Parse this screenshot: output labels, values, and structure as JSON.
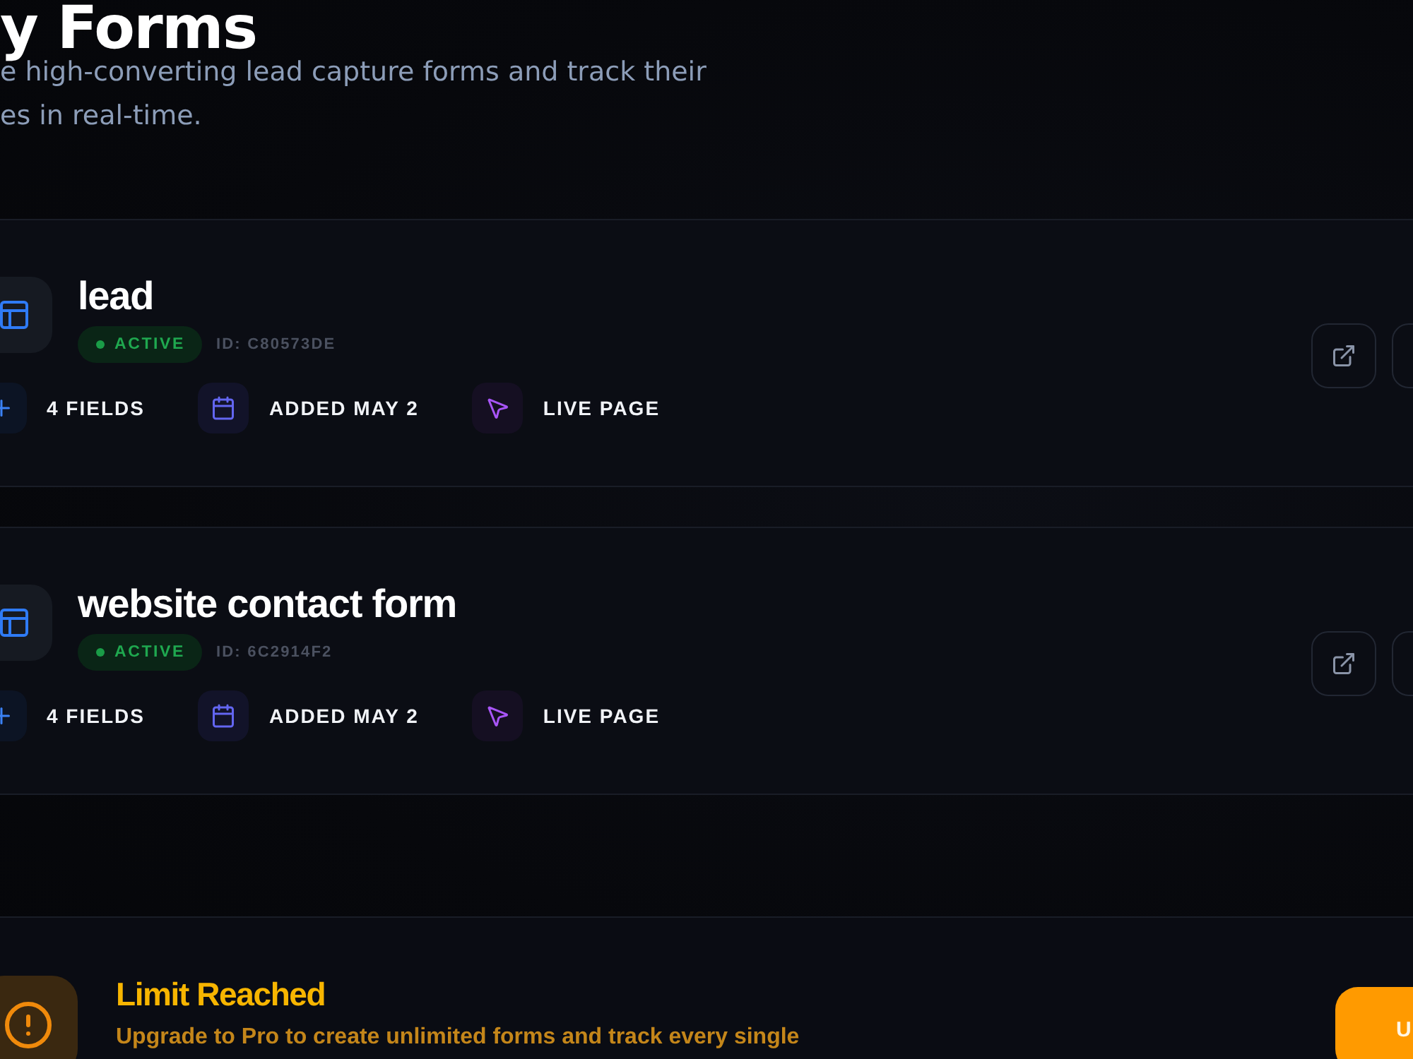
{
  "header": {
    "title": "y Forms",
    "subtitle_lines": [
      "e high-converting lead capture forms and track their",
      "es in real-time."
    ]
  },
  "forms": [
    {
      "name": "lead",
      "status": "ACTIVE",
      "id_label": "ID: C80573DE",
      "stats": [
        {
          "kind": "fields",
          "label": "4 FIELDS"
        },
        {
          "kind": "date",
          "label": "ADDED MAY 2"
        },
        {
          "kind": "page",
          "label": "LIVE PAGE"
        }
      ]
    },
    {
      "name": "website contact form",
      "status": "ACTIVE",
      "id_label": "ID: 6C2914F2",
      "stats": [
        {
          "kind": "fields",
          "label": "4 FIELDS"
        },
        {
          "kind": "date",
          "label": "ADDED MAY 2"
        },
        {
          "kind": "page",
          "label": "LIVE PAGE"
        }
      ]
    }
  ],
  "limit_notice": {
    "title": "Limit Reached",
    "message": "Upgrade to Pro to create unlimited forms and track every single",
    "button": "U"
  }
}
